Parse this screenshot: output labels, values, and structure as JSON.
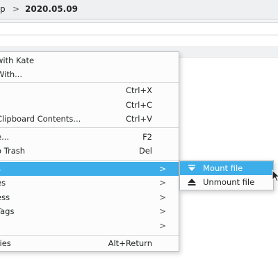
{
  "breadcrumb": {
    "prev": "p",
    "separator": ">",
    "current": "2020.05.09"
  },
  "context_menu": {
    "items": [
      {
        "label": "with Kate",
        "shortcut": "",
        "has_submenu": false
      },
      {
        "label": "With...",
        "shortcut": "",
        "has_submenu": false
      },
      {
        "label": "",
        "shortcut": "Ctrl+X",
        "has_submenu": false
      },
      {
        "label": "",
        "shortcut": "Ctrl+C",
        "has_submenu": false
      },
      {
        "label": "Clipboard Contents...",
        "shortcut": "Ctrl+V",
        "has_submenu": false
      },
      {
        "label": "e...",
        "shortcut": "F2",
        "has_submenu": false
      },
      {
        "label": "o Trash",
        "shortcut": "Del",
        "has_submenu": false
      },
      {
        "label": "s",
        "shortcut": "",
        "has_submenu": true,
        "active": true
      },
      {
        "label": "es",
        "shortcut": "",
        "has_submenu": true
      },
      {
        "label": "ess",
        "shortcut": "",
        "has_submenu": true
      },
      {
        "label": "Tags",
        "shortcut": "",
        "has_submenu": true
      },
      {
        "label": "",
        "shortcut": "",
        "has_submenu": true
      },
      {
        "label": "ties",
        "shortcut": "Alt+Return",
        "has_submenu": false
      }
    ],
    "arrow_glyph": ">"
  },
  "submenu": {
    "items": [
      {
        "label": "Mount file",
        "icon": "mount-icon",
        "active": true
      },
      {
        "label": "Unmount file",
        "icon": "eject-icon",
        "active": false
      }
    ]
  },
  "colors": {
    "highlight": "#3daee9",
    "menu_bg": "#fcfcfc",
    "text": "#232627"
  }
}
